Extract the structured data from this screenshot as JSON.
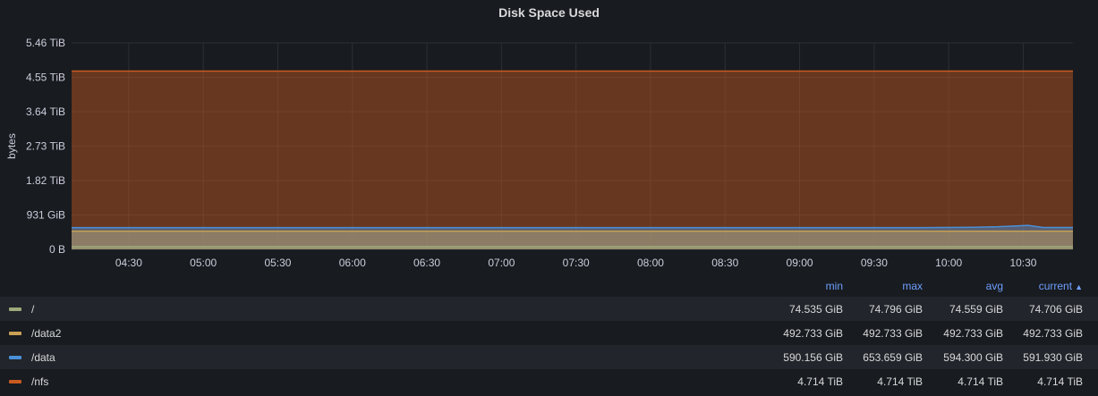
{
  "panel": {
    "title": "Disk Space Used"
  },
  "colors": {
    "background": "#181b1f",
    "grid": "#2c2f36",
    "text": "#ccccdc",
    "header_text": "#6e9fff"
  },
  "chart_data": {
    "type": "area",
    "title": "Disk Space Used",
    "xlabel": "",
    "ylabel": "bytes",
    "y_unit": "TiB",
    "ylim": [
      0,
      5.46
    ],
    "y_ticks": [
      {
        "value": 0,
        "label": "0 B"
      },
      {
        "value": 0.909,
        "label": "931 GiB"
      },
      {
        "value": 1.82,
        "label": "1.82 TiB"
      },
      {
        "value": 2.73,
        "label": "2.73 TiB"
      },
      {
        "value": 3.64,
        "label": "3.64 TiB"
      },
      {
        "value": 4.55,
        "label": "4.55 TiB"
      },
      {
        "value": 5.46,
        "label": "5.46 TiB"
      }
    ],
    "x_range": [
      "04:07",
      "10:50"
    ],
    "x_ticks": [
      "04:30",
      "05:00",
      "05:30",
      "06:00",
      "06:30",
      "07:00",
      "07:30",
      "08:00",
      "08:30",
      "09:00",
      "09:30",
      "10:00",
      "10:30"
    ],
    "grid": true,
    "legend_position": "bottom",
    "series": [
      {
        "name": "/",
        "color": "#9fa87a",
        "x": [
          "04:07",
          "10:50"
        ],
        "values": [
          0.0728,
          0.073
        ]
      },
      {
        "name": "/data2",
        "color": "#c9a055",
        "x": [
          "04:07",
          "10:50"
        ],
        "values": [
          0.4813,
          0.4813
        ]
      },
      {
        "name": "/data",
        "color": "#4a90d9",
        "x": [
          "04:07",
          "09:20",
          "09:50",
          "10:10",
          "10:20",
          "10:32",
          "10:38",
          "10:50"
        ],
        "values": [
          0.575,
          0.576,
          0.577,
          0.585,
          0.6,
          0.636,
          0.578,
          0.578
        ]
      },
      {
        "name": "/nfs",
        "color": "#c85a20",
        "x": [
          "04:07",
          "10:50"
        ],
        "values": [
          4.714,
          4.714
        ]
      }
    ]
  },
  "legend": {
    "headers": {
      "min": "min",
      "max": "max",
      "avg": "avg",
      "current": "current"
    },
    "sort_icon": "chevron-up-icon",
    "rows": [
      {
        "name": "/",
        "color": "#9fa87a",
        "min": "74.535 GiB",
        "max": "74.796 GiB",
        "avg": "74.559 GiB",
        "current": "74.706 GiB"
      },
      {
        "name": "/data2",
        "color": "#c9a055",
        "min": "492.733 GiB",
        "max": "492.733 GiB",
        "avg": "492.733 GiB",
        "current": "492.733 GiB"
      },
      {
        "name": "/data",
        "color": "#4a90d9",
        "min": "590.156 GiB",
        "max": "653.659 GiB",
        "avg": "594.300 GiB",
        "current": "591.930 GiB"
      },
      {
        "name": "/nfs",
        "color": "#c85a20",
        "min": "4.714 TiB",
        "max": "4.714 TiB",
        "avg": "4.714 TiB",
        "current": "4.714 TiB"
      }
    ]
  }
}
